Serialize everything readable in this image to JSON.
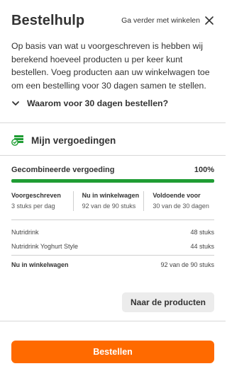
{
  "header": {
    "title": "Bestelhulp",
    "continue_label": "Ga verder met winkelen"
  },
  "intro": {
    "text": "Op basis van wat u voorgeschreven is hebben wij berekend hoeveel producten u per keer kunt bestellen. Voeg producten aan uw winkelwagen toe om een bestelling voor 30 dagen samen te stellen."
  },
  "why": {
    "label": "Waarom voor 30 dagen bestellen?"
  },
  "vergoedingen": {
    "title": "Mijn vergoedingen",
    "combined_label": "Gecombineerde vergoeding",
    "combined_percent": "100%",
    "progress_fraction": 1.0,
    "progress_color": "#1f9d34",
    "stats": [
      {
        "label": "Voorgeschreven",
        "value": "3 stuks per dag"
      },
      {
        "label": "Nu in winkelwagen",
        "value": "92 van de 90 stuks"
      },
      {
        "label": "Voldoende voor",
        "value": "30 van de 30 dagen"
      }
    ],
    "products": [
      {
        "name": "Nutridrink",
        "qty": "48 stuks"
      },
      {
        "name": "Nutridrink Yoghurt Style",
        "qty": "44 stuks"
      }
    ],
    "total": {
      "label": "Nu in winkelwagen",
      "value": "92 van de 90 stuks"
    }
  },
  "actions": {
    "products_button": "Naar de producten",
    "order_button": "Bestellen",
    "order_color": "#ff6a00"
  },
  "icons": {
    "close": "close-icon",
    "chevron": "chevron-down-icon",
    "money": "money-icon"
  }
}
